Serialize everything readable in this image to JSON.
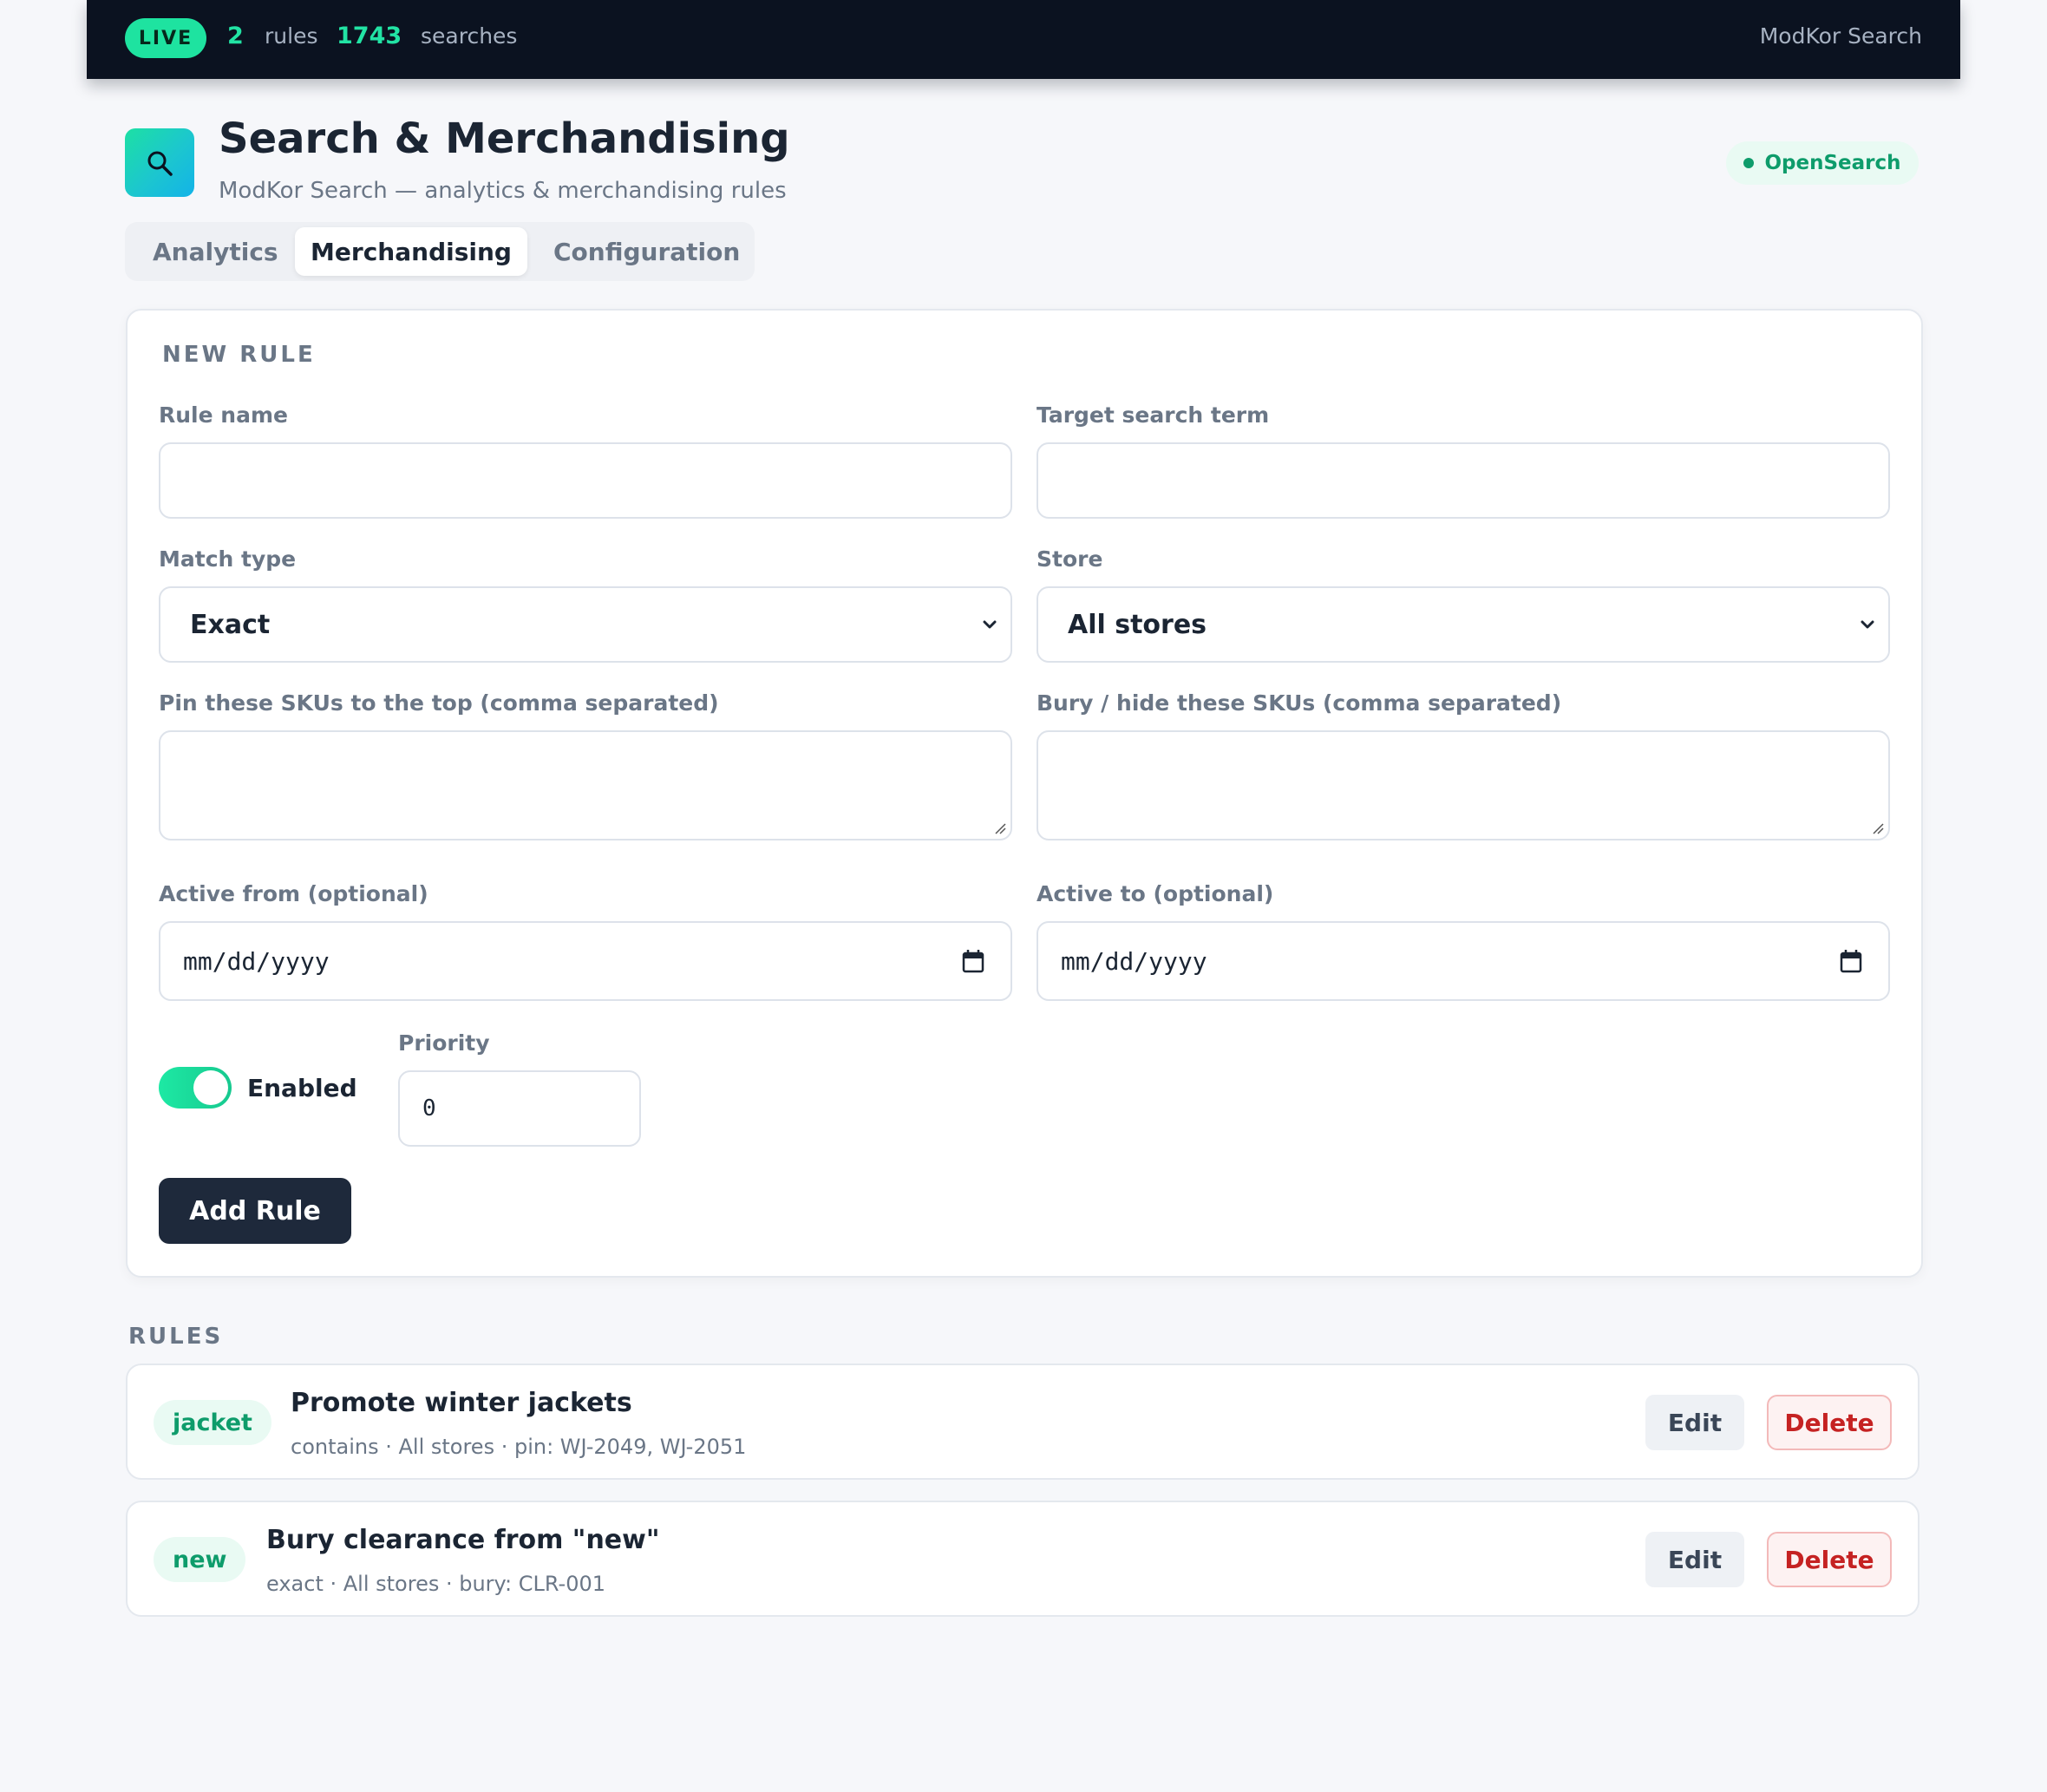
{
  "topbar": {
    "live_label": "LIVE",
    "rules_count": "2",
    "rules_label": "rules",
    "searches_count": "1743",
    "searches_label": "searches",
    "brand": "ModKor Search"
  },
  "header": {
    "icon": "search-icon",
    "title": "Search & Merchandising",
    "subtitle": "ModKor Search — analytics & merchandising rules",
    "engine_badge": "OpenSearch"
  },
  "tabs": [
    {
      "label": "Analytics",
      "active": false
    },
    {
      "label": "Merchandising",
      "active": true
    },
    {
      "label": "Configuration",
      "active": false
    }
  ],
  "new_rule": {
    "heading": "NEW RULE",
    "rule_name_label": "Rule name",
    "rule_name_value": "",
    "target_term_label": "Target search term",
    "target_term_value": "",
    "match_type_label": "Match type",
    "match_type_value": "Exact",
    "store_label": "Store",
    "store_value": "All stores",
    "pin_label": "Pin these SKUs to the top (comma separated)",
    "pin_value": "",
    "bury_label": "Bury / hide these SKUs (comma separated)",
    "bury_value": "",
    "active_from_label": "Active from (optional)",
    "active_from_value": "mm/dd/yyyy",
    "active_to_label": "Active to (optional)",
    "active_to_value": "mm/dd/yyyy",
    "enabled_label": "Enabled",
    "enabled": true,
    "priority_label": "Priority",
    "priority_value": "0",
    "submit_label": "Add Rule"
  },
  "rules": {
    "heading": "RULES",
    "items": [
      {
        "term": "jacket",
        "title": "Promote winter jackets",
        "meta": "contains · All stores · pin: WJ-2049, WJ-2051",
        "edit_label": "Edit",
        "delete_label": "Delete"
      },
      {
        "term": "new",
        "title": "Bury clearance from \"new\"",
        "meta": "exact · All stores · bury: CLR-001",
        "edit_label": "Edit",
        "delete_label": "Delete"
      }
    ]
  },
  "colors": {
    "accent": "#1ee3a0",
    "topbar_bg": "#0b1220",
    "primary_button": "#1e293b",
    "danger": "#c52222",
    "success_text": "#0e9c6b"
  }
}
